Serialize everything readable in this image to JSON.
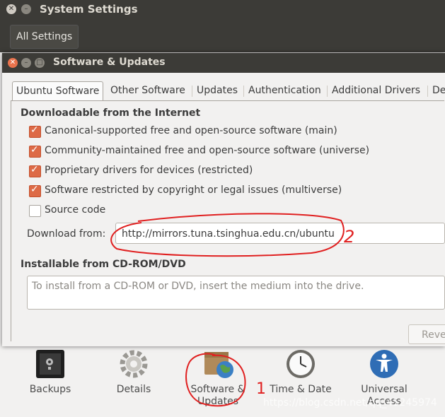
{
  "background_window": {
    "title": "System Settings",
    "all_settings_label": "All Settings",
    "apps": [
      {
        "label": "Backups",
        "icon": "safe-icon"
      },
      {
        "label": "Details",
        "icon": "gear-icon"
      },
      {
        "label": "Software & Updates",
        "icon": "package-globe-icon"
      },
      {
        "label": "Time & Date",
        "icon": "clock-icon"
      },
      {
        "label": "Universal Access",
        "icon": "accessibility-icon"
      }
    ]
  },
  "dialog": {
    "title": "Software & Updates",
    "tabs": [
      "Ubuntu Software",
      "Other Software",
      "Updates",
      "Authentication",
      "Additional Drivers",
      "De"
    ],
    "active_tab": "Ubuntu Software",
    "section_downloadable": "Downloadable from the Internet",
    "sources": [
      {
        "label": "Canonical-supported free and open-source software (main)",
        "checked": true
      },
      {
        "label": "Community-maintained free and open-source software (universe)",
        "checked": true
      },
      {
        "label": "Proprietary drivers for devices (restricted)",
        "checked": true
      },
      {
        "label": "Software restricted by copyright or legal issues (multiverse)",
        "checked": true
      },
      {
        "label": "Source code",
        "checked": false
      }
    ],
    "download_from_label": "Download from:",
    "download_from_value": "http://mirrors.tuna.tsinghua.edu.cn/ubuntu",
    "section_cdrom": "Installable from CD-ROM/DVD",
    "cdrom_placeholder": "To install from a CD-ROM or DVD, insert the medium into the drive.",
    "revert_label": "Reve"
  },
  "annotations": {
    "mark_1": "1",
    "mark_2": "2"
  },
  "watermark": "https://blog.csdn.net/qq_45245974",
  "colors": {
    "accent": "#dd6a46",
    "titlebar": "#3c3b37",
    "annotation": "#e02020"
  }
}
